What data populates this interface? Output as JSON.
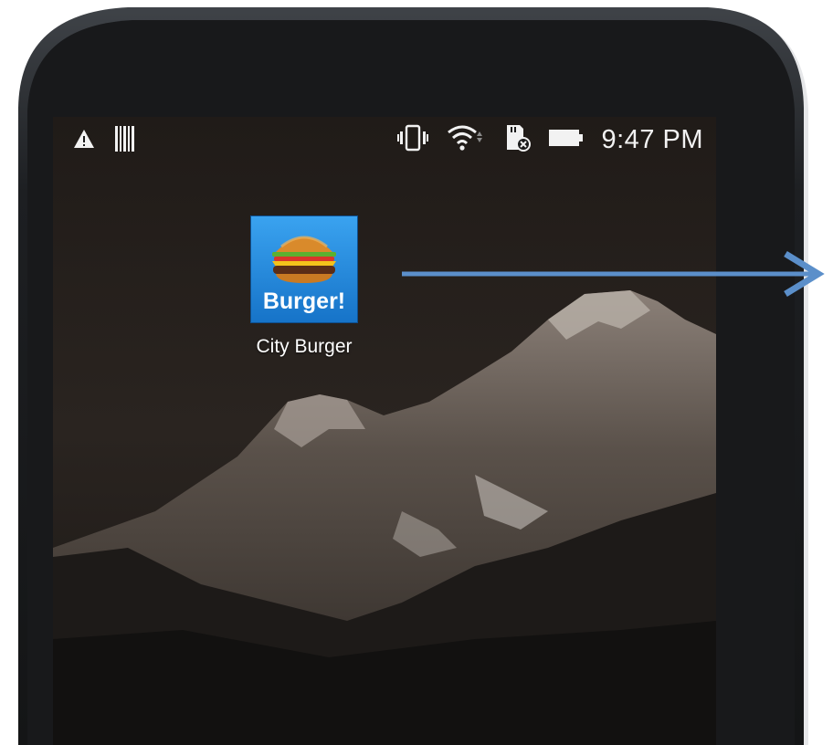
{
  "status_bar": {
    "left_icons": [
      "warning-icon",
      "barcode-icon"
    ],
    "right_icons": [
      "vibrate-icon",
      "wifi-icon",
      "sd-card-error-icon",
      "battery-icon"
    ],
    "time": "9:47 PM"
  },
  "home_screen": {
    "wallpaper": "mountain-night",
    "apps": [
      {
        "label": "City Burger",
        "icon_text": "Burger!",
        "icon": "burger-icon",
        "icon_bg": "#1e8fe0"
      }
    ]
  },
  "annotation": {
    "arrow_color": "#5b8fca",
    "arrow_direction": "right"
  }
}
